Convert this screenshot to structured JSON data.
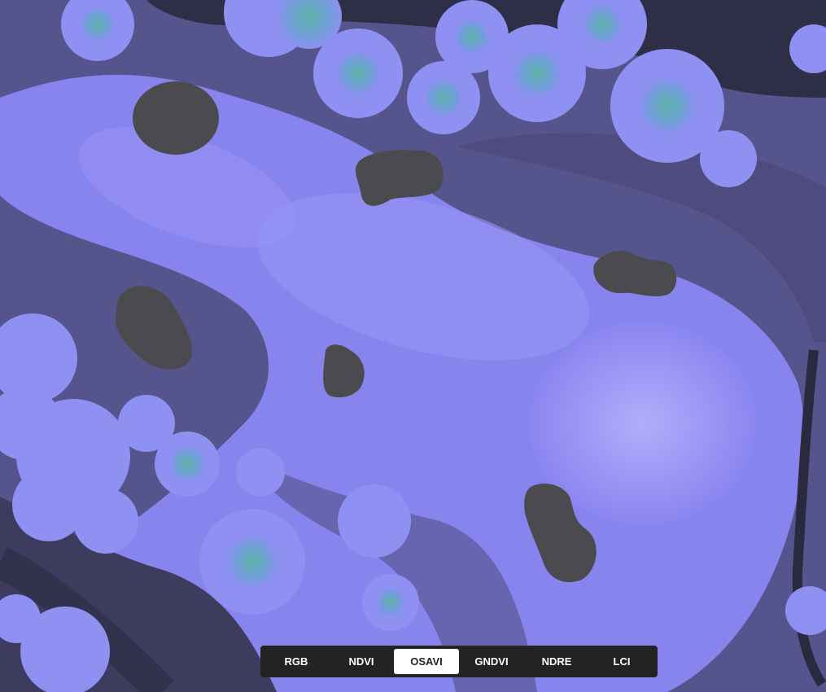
{
  "layer_switcher": {
    "buttons": [
      {
        "label": "RGB",
        "active": false
      },
      {
        "label": "NDVI",
        "active": false
      },
      {
        "label": "OSAVI",
        "active": true
      },
      {
        "label": "GNDVI",
        "active": false
      },
      {
        "label": "NDRE",
        "active": false
      },
      {
        "label": "LCI",
        "active": false
      }
    ]
  },
  "colors": {
    "turf": "#8a86f0",
    "turf_light": "#9b98f7",
    "rough": "#5a5890",
    "dark_ground": "#2e2d44",
    "water": "#4a4a4e",
    "tree_canopy": "#8e90f2",
    "tree_highlight": "#5fb3a8",
    "toolbar_bg": "#232323"
  }
}
